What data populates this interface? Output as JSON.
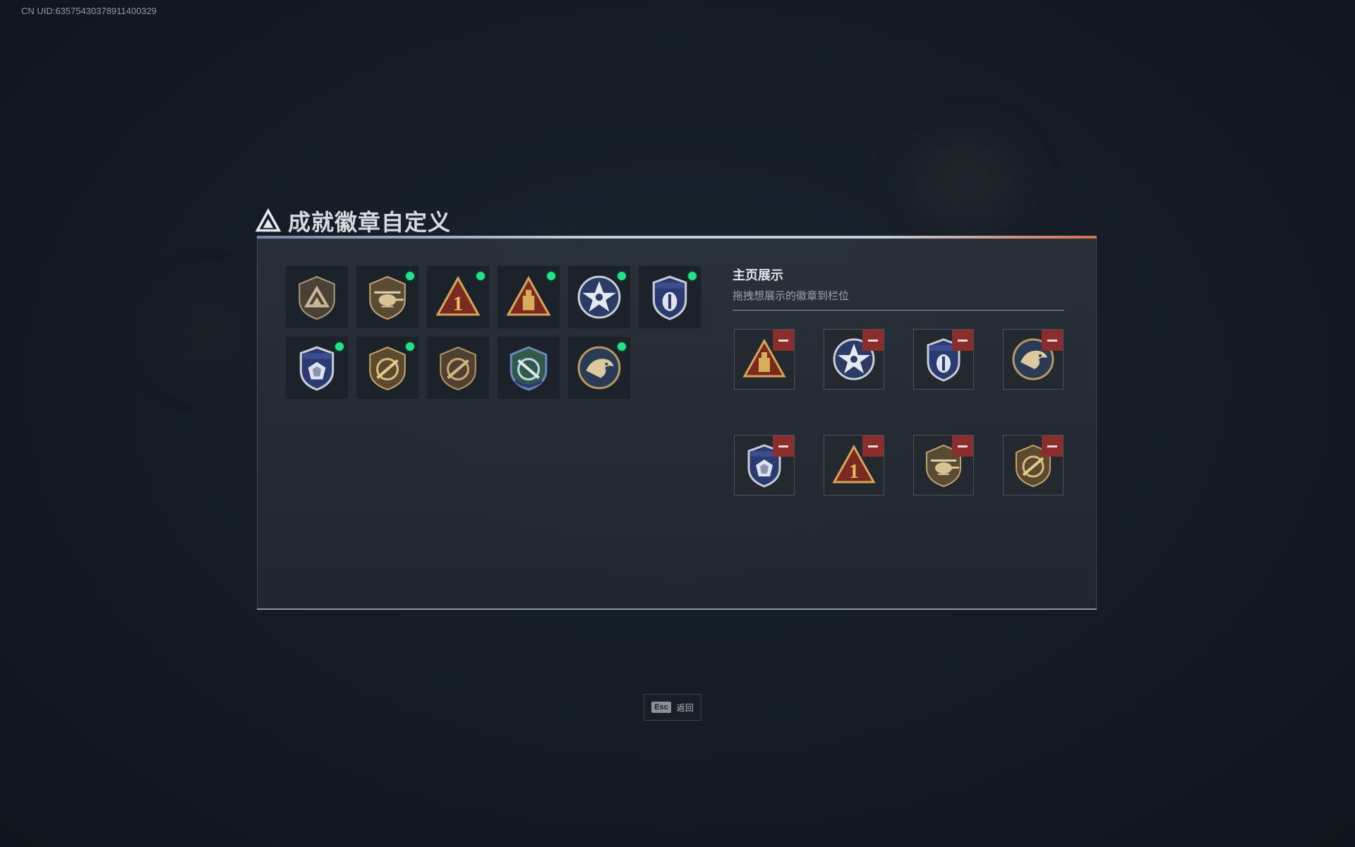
{
  "header": {
    "uid": "CN UID:635754303789114003​29"
  },
  "title": "成就徽章自定义",
  "inventory": [
    {
      "badge": "delta-shield",
      "new": false
    },
    {
      "badge": "helicopter-shield",
      "new": true
    },
    {
      "badge": "red-triangle-one",
      "new": true
    },
    {
      "badge": "red-triangle-tower",
      "new": true
    },
    {
      "badge": "star-silver-round",
      "new": true
    },
    {
      "badge": "police-shield-blue",
      "new": true
    },
    {
      "badge": "police-shield-crest",
      "new": true
    },
    {
      "badge": "rifle-shield-gold",
      "new": true
    },
    {
      "badge": "rifle-shield-bronze",
      "new": false
    },
    {
      "badge": "green-cross-shield",
      "new": false
    },
    {
      "badge": "eagle-round",
      "new": true
    }
  ],
  "showcase": {
    "title": "主页展示",
    "subtitle": "拖拽想展示的徽章到栏位",
    "slots": [
      "red-triangle-tower",
      "star-silver-round",
      "police-shield-blue",
      "eagle-round",
      "police-shield-crest",
      "red-triangle-one",
      "helicopter-shield",
      "rifle-shield-gold"
    ]
  },
  "footer": {
    "esc_key": "Esc",
    "esc_label": "返回"
  },
  "colors": {
    "new_dot": "#26e08c",
    "remove": "#8a2d2d"
  }
}
